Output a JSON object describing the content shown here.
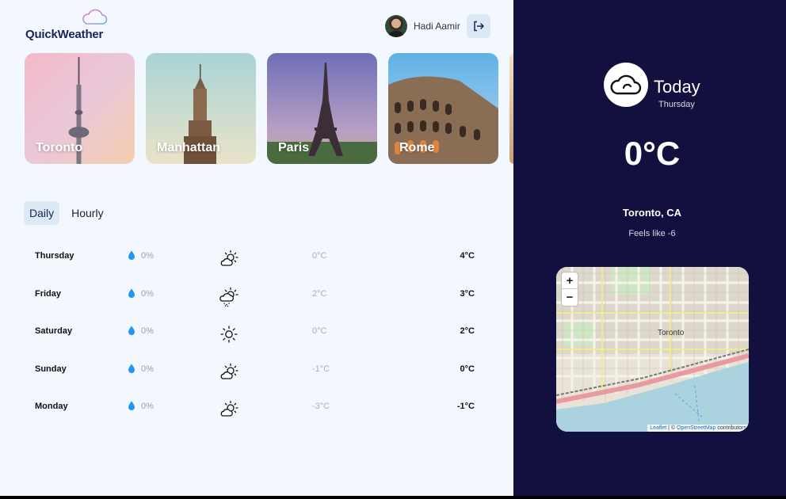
{
  "app": {
    "name": "QuickWeather"
  },
  "user": {
    "name": "Hadi Aamir"
  },
  "cities": [
    {
      "name": "Toronto"
    },
    {
      "name": "Manhattan"
    },
    {
      "name": "Paris"
    },
    {
      "name": "Rome"
    }
  ],
  "tabs": {
    "daily": "Daily",
    "hourly": "Hourly",
    "active": "Daily"
  },
  "forecast": [
    {
      "day": "Thursday",
      "precip": "0%",
      "icon": "partly-cloudy-day-icon",
      "low": "0°C",
      "high": "4°C"
    },
    {
      "day": "Friday",
      "precip": "0%",
      "icon": "snow-partly-cloudy-icon",
      "low": "2°C",
      "high": "3°C"
    },
    {
      "day": "Saturday",
      "precip": "0%",
      "icon": "sun-icon",
      "low": "0°C",
      "high": "2°C"
    },
    {
      "day": "Sunday",
      "precip": "0%",
      "icon": "partly-cloudy-day-icon",
      "low": "-1°C",
      "high": "0°C"
    },
    {
      "day": "Monday",
      "precip": "0%",
      "icon": "partly-cloudy-day-icon",
      "low": "-3°C",
      "high": "-1°C"
    }
  ],
  "today": {
    "title": "Today",
    "day": "Thursday",
    "temp": "0°C",
    "location": "Toronto, CA",
    "feels_like": "Feels like -6",
    "icon": "cloud-icon"
  },
  "map": {
    "zoom_in": "+",
    "zoom_out": "−",
    "label": "Toronto",
    "attribution_leaflet": "Leaflet",
    "attribution_sep": " | © ",
    "attribution_osm": "OpenStreetMap",
    "attribution_suffix": " contributors"
  },
  "colors": {
    "panel_bg": "#12103f",
    "main_bg": "#f2f8fe",
    "accent": "#1b2357",
    "drop": "#2196f3"
  }
}
